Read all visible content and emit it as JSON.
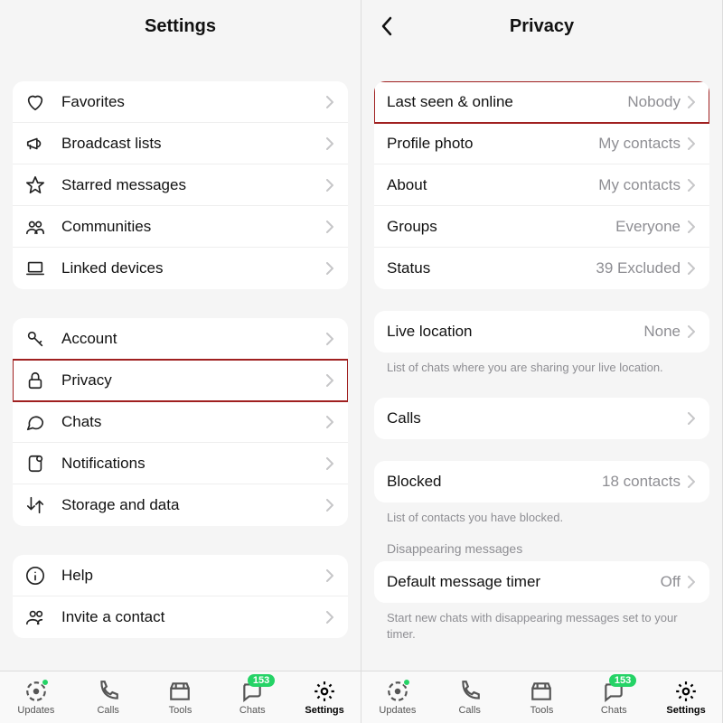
{
  "left": {
    "title": "Settings",
    "group1": [
      {
        "icon": "heart",
        "label": "Favorites"
      },
      {
        "icon": "megaphone",
        "label": "Broadcast lists"
      },
      {
        "icon": "star",
        "label": "Starred messages"
      },
      {
        "icon": "communities",
        "label": "Communities"
      },
      {
        "icon": "laptop",
        "label": "Linked devices"
      }
    ],
    "group2": [
      {
        "icon": "key",
        "label": "Account"
      },
      {
        "icon": "lock",
        "label": "Privacy",
        "highlight": true
      },
      {
        "icon": "chat",
        "label": "Chats"
      },
      {
        "icon": "notification",
        "label": "Notifications"
      },
      {
        "icon": "storage",
        "label": "Storage and data"
      }
    ],
    "group3": [
      {
        "icon": "info",
        "label": "Help"
      },
      {
        "icon": "invite",
        "label": "Invite a contact"
      }
    ]
  },
  "right": {
    "title": "Privacy",
    "group1": [
      {
        "label": "Last seen & online",
        "value": "Nobody",
        "highlight": true
      },
      {
        "label": "Profile photo",
        "value": "My contacts"
      },
      {
        "label": "About",
        "value": "My contacts"
      },
      {
        "label": "Groups",
        "value": "Everyone"
      },
      {
        "label": "Status",
        "value": "39 Excluded"
      }
    ],
    "liveLocation": {
      "label": "Live location",
      "value": "None"
    },
    "liveLocationFoot": "List of chats where you are sharing your live location.",
    "calls": {
      "label": "Calls"
    },
    "blocked": {
      "label": "Blocked",
      "value": "18 contacts"
    },
    "blockedFoot": "List of contacts you have blocked.",
    "disappearingHead": "Disappearing messages",
    "defaultTimer": {
      "label": "Default message timer",
      "value": "Off"
    },
    "defaultTimerFoot": "Start new chats with disappearing messages set to your timer."
  },
  "tabbar": {
    "items": [
      {
        "icon": "updates",
        "label": "Updates",
        "dot": true
      },
      {
        "icon": "calls",
        "label": "Calls"
      },
      {
        "icon": "tools",
        "label": "Tools"
      },
      {
        "icon": "chats",
        "label": "Chats",
        "badge": "153"
      },
      {
        "icon": "settings",
        "label": "Settings",
        "active": true
      }
    ]
  }
}
